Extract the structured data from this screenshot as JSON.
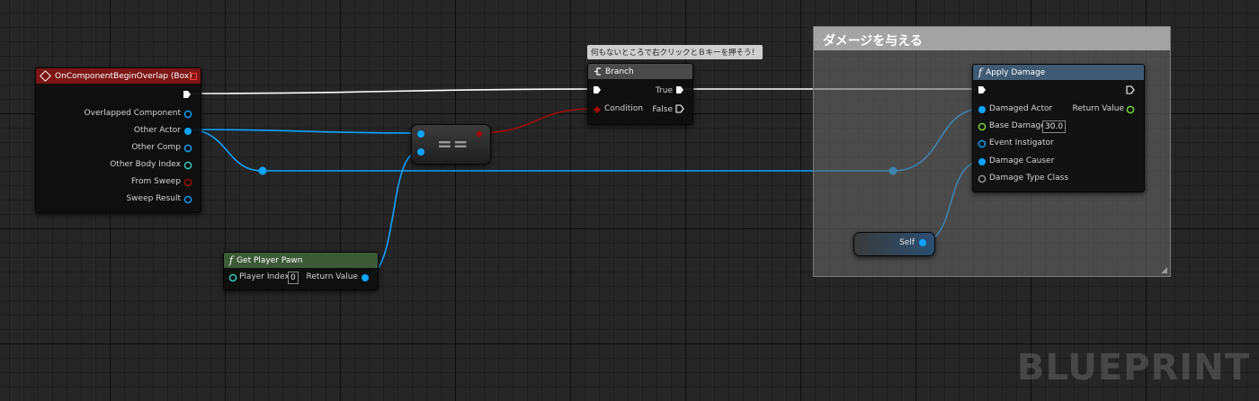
{
  "comment": {
    "title": "ダメージを与える"
  },
  "tooltip": "何もないところで右クリックとＢキーを押そう！",
  "watermark": "BLUEPRINT",
  "colors": {
    "exec": "#ffffff",
    "object": "#0ea4ff",
    "bool": "#a20a0a",
    "float": "#7edb3a",
    "struct": "#38d6c4",
    "class": "#9b9b9b",
    "eventHeader": "#7c1515",
    "funcHeader": "#3f5a72",
    "pureHeader": "#3d5a37"
  },
  "event_node": {
    "title": "OnComponentBeginOverlap (Box)",
    "pins": [
      "Overlapped Component",
      "Other Actor",
      "Other Comp",
      "Other Body Index",
      "From Sweep",
      "Sweep Result"
    ]
  },
  "branch_node": {
    "title": "Branch",
    "condition": "Condition",
    "true_label": "True",
    "false_label": "False"
  },
  "equal_node": {
    "symbol": "=="
  },
  "pawn_node": {
    "title": "Get Player Pawn",
    "player_index_label": "Player Index",
    "player_index_value": "0",
    "return_label": "Return Value"
  },
  "damage_node": {
    "title": "Apply Damage",
    "damaged_actor": "Damaged Actor",
    "base_damage": "Base Damage",
    "base_damage_value": "30.0",
    "event_instigator": "Event Instigator",
    "damage_causer": "Damage Causer",
    "damage_type_class": "Damage Type Class",
    "return_label": "Return Value"
  },
  "self_node": {
    "label": "Self"
  },
  "icons": {
    "event": "event-diamond-icon",
    "branch": "branch-icon",
    "function": "function-f-icon"
  }
}
